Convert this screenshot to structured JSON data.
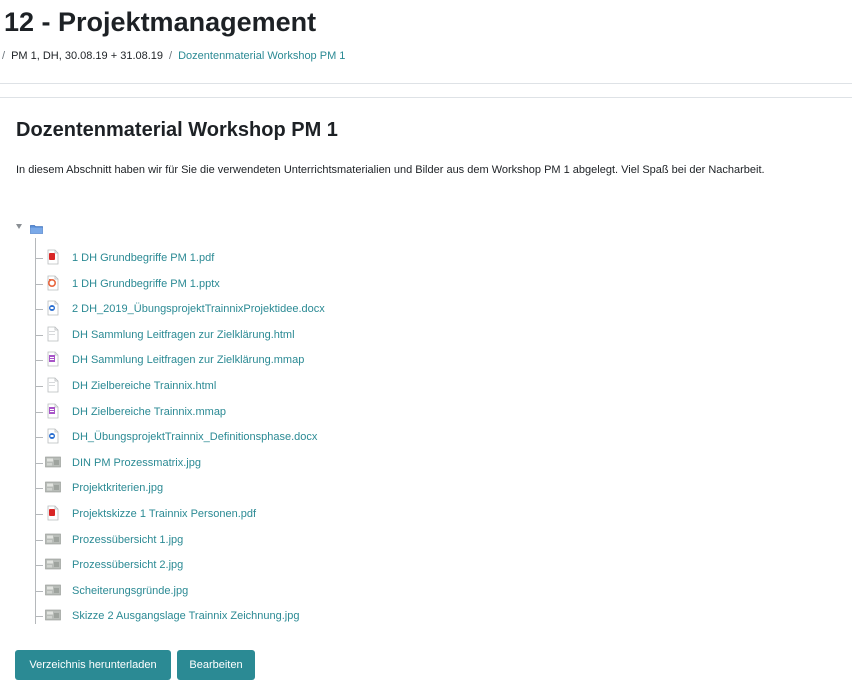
{
  "page": {
    "title": "12 - Projektmanagement"
  },
  "breadcrumb": {
    "separator": "/",
    "items": [
      {
        "label": "PM 1, DH, 30.08.19 + 31.08.19"
      },
      {
        "label": "Dozentenmaterial Workshop PM 1"
      }
    ]
  },
  "section": {
    "title": "Dozentenmaterial Workshop PM 1",
    "intro": "In diesem Abschnitt haben wir für Sie die verwendeten Unterrichtsmaterialien und Bilder aus dem Workshop PM 1 abgelegt. Viel Spaß bei der Nacharbeit."
  },
  "files": [
    {
      "name": "1 DH Grundbegriffe PM 1.pdf",
      "icon": "pdf-icon"
    },
    {
      "name": "1 DH Grundbegriffe PM 1.pptx",
      "icon": "powerpoint-icon"
    },
    {
      "name": "2 DH_2019_ÜbungsprojektTrainnixProjektidee.docx",
      "icon": "word-icon"
    },
    {
      "name": "DH Sammlung Leitfragen zur Zielklärung.html",
      "icon": "html-icon"
    },
    {
      "name": "DH Sammlung Leitfragen zur Zielklärung.mmap",
      "icon": "mindmap-icon"
    },
    {
      "name": "DH Zielbereiche Trainnix.html",
      "icon": "html-icon"
    },
    {
      "name": "DH Zielbereiche Trainnix.mmap",
      "icon": "mindmap-icon"
    },
    {
      "name": "DH_ÜbungsprojektTrainnix_Definitionsphase.docx",
      "icon": "word-icon"
    },
    {
      "name": "DIN PM Prozessmatrix.jpg",
      "icon": "image-thumbnail-icon"
    },
    {
      "name": "Projektkriterien.jpg",
      "icon": "image-thumbnail-icon"
    },
    {
      "name": "Projektskizze 1 Trainnix Personen.pdf",
      "icon": "pdf-icon"
    },
    {
      "name": "Prozessübersicht 1.jpg",
      "icon": "image-thumbnail-icon"
    },
    {
      "name": "Prozessübersicht 2.jpg",
      "icon": "image-thumbnail-icon"
    },
    {
      "name": "Scheiterungsgründe.jpg",
      "icon": "image-thumbnail-icon"
    },
    {
      "name": "Skizze 2 Ausgangslage Trainnix Zeichnung.jpg",
      "icon": "image-thumbnail-icon"
    }
  ],
  "buttons": {
    "download_label": "Verzeichnis herunterladen",
    "edit_label": "Bearbeiten"
  },
  "colors": {
    "link": "#2b8a94",
    "button_bg": "#2b8a94",
    "pdf": "#d92626",
    "pptx": "#e8663e",
    "docx": "#2b6fd1",
    "mmap": "#a855c8",
    "folder": "#5a8fd8"
  }
}
